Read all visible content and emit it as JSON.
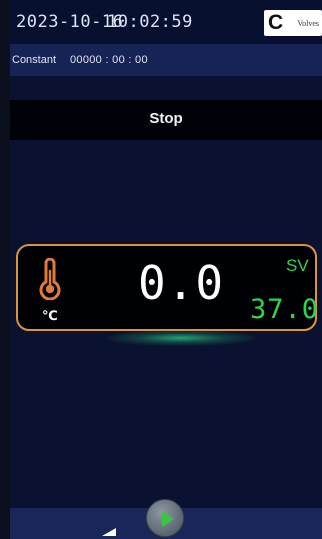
{
  "header": {
    "date": "2023-10-16",
    "time": "10:02:59",
    "valve_badge": {
      "letter": "C",
      "label": "Volves"
    }
  },
  "mode_bar": {
    "mode": "Constant",
    "timer": "00000 : 00 : 00"
  },
  "status": {
    "label": "Stop"
  },
  "temperature": {
    "unit": "℃",
    "pv": "0.0",
    "sv_label": "SV",
    "sv_value": "37.0",
    "icon": "thermometer-icon"
  },
  "controls": {
    "play_icon": "play-icon"
  },
  "colors": {
    "background": "#0a1230",
    "panel_border": "#d9953a",
    "sv_green": "#2fd548",
    "play_green": "#3cc447"
  }
}
